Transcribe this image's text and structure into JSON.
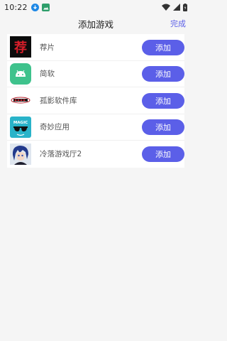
{
  "status": {
    "time": "10:22"
  },
  "header": {
    "title": "添加游戏",
    "done_label": "完成"
  },
  "colors": {
    "accent": "#5b5fe8"
  },
  "apps": [
    {
      "name": "荐片",
      "icon": "jianpian-logo-icon",
      "button": "添加"
    },
    {
      "name": "简软",
      "icon": "android-robot-icon",
      "button": "添加"
    },
    {
      "name": "孤影软件库",
      "icon": "guying-logo-icon",
      "button": "添加"
    },
    {
      "name": "奇妙应用",
      "icon": "magic-sunglasses-icon",
      "button": "添加"
    },
    {
      "name": "冷落游戏厅2",
      "icon": "anime-avatar-icon",
      "button": "添加"
    }
  ]
}
